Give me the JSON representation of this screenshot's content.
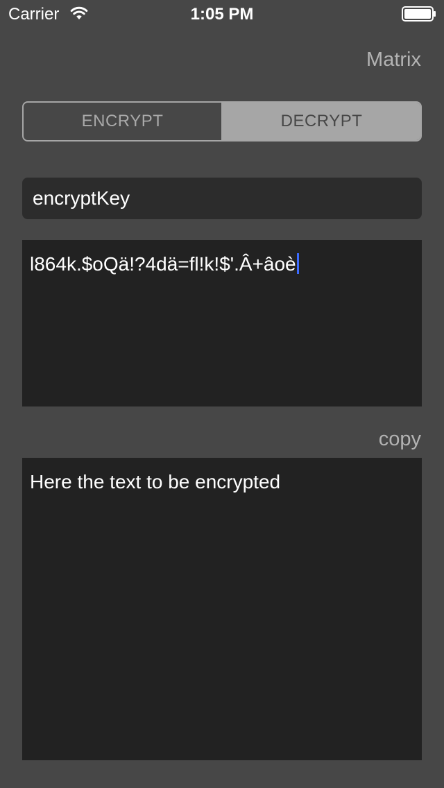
{
  "status_bar": {
    "carrier": "Carrier",
    "time": "1:05 PM"
  },
  "nav": {
    "matrix_label": "Matrix"
  },
  "segmented_control": {
    "encrypt_label": "ENCRYPT",
    "decrypt_label": "DECRYPT",
    "selected": "DECRYPT"
  },
  "key_field": {
    "value": "encryptKey"
  },
  "cipher_text": {
    "value": "l864k.$oQä!?4dä=fl!k!$'.Â+âoè"
  },
  "copy": {
    "label": "copy"
  },
  "plain_text": {
    "value": "Here the text to be encrypted"
  },
  "colors": {
    "background": "#474747",
    "field": "#2c2c2c",
    "textbox": "#222222",
    "accent_gray": "#a6a6a6",
    "cursor": "#3c6bff"
  }
}
